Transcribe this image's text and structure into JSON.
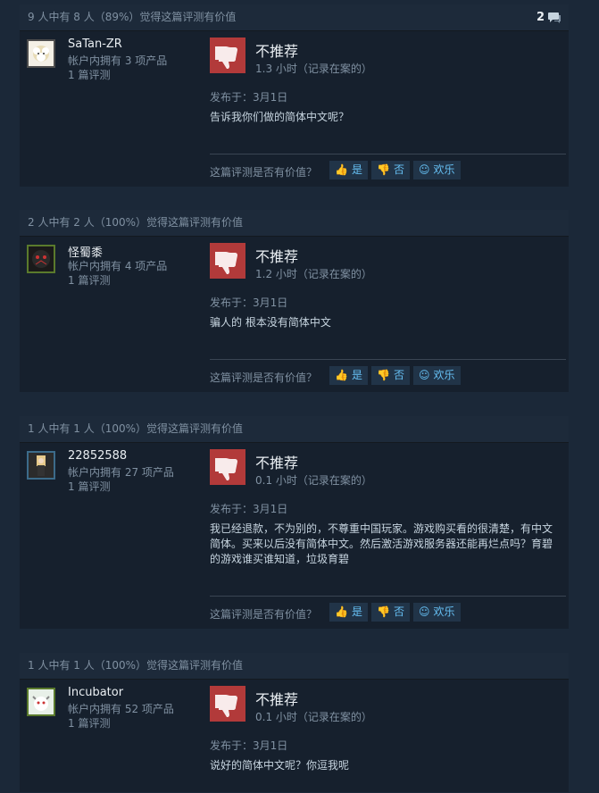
{
  "reviews": [
    {
      "helpful_text": "9 人中有 8 人（89%）觉得这篇评测有价值",
      "comment_count": "2",
      "author": "SaTan-ZR",
      "owned": "帐户内拥有 3 项产品",
      "reviews_count": "1 篇评测",
      "verdict": "不推荐",
      "hours": "1.3 小时（记录在案的）",
      "posted": "发布于：3月1日",
      "content": "告诉我你们做的简体中文呢？",
      "helpful_question": "这篇评测是否有价值？",
      "yes": "是",
      "no": "否",
      "funny": "欢乐"
    },
    {
      "helpful_text": "2 人中有 2 人（100%）觉得这篇评测有价值",
      "author": "怪蜀黍",
      "owned": "帐户内拥有 4 项产品",
      "reviews_count": "1 篇评测",
      "verdict": "不推荐",
      "hours": "1.2 小时（记录在案的）",
      "posted": "发布于：3月1日",
      "content": "骗人的 根本没有简体中文",
      "helpful_question": "这篇评测是否有价值？",
      "yes": "是",
      "no": "否",
      "funny": "欢乐"
    },
    {
      "helpful_text": "1 人中有 1 人（100%）觉得这篇评测有价值",
      "author": "22852588",
      "owned": "帐户内拥有 27 项产品",
      "reviews_count": "1 篇评测",
      "verdict": "不推荐",
      "hours": "0.1 小时（记录在案的）",
      "posted": "发布于：3月1日",
      "content": "我已经退款，不为别的，不尊重中国玩家。游戏购买看的很清楚，有中文简体。买来以后没有简体中文。然后激活游戏服务器还能再烂点吗？育碧的游戏谁买谁知道，垃圾育碧",
      "helpful_question": "这篇评测是否有价值？",
      "yes": "是",
      "no": "否",
      "funny": "欢乐"
    },
    {
      "helpful_text": "1 人中有 1 人（100%）觉得这篇评测有价值",
      "author": "Incubator",
      "owned": "帐户内拥有 52 项产品",
      "reviews_count": "1 篇评测",
      "verdict": "不推荐",
      "hours": "0.1 小时（记录在案的）",
      "posted": "发布于：3月1日",
      "content": "说好的简体中文呢？你逗我呢"
    }
  ]
}
